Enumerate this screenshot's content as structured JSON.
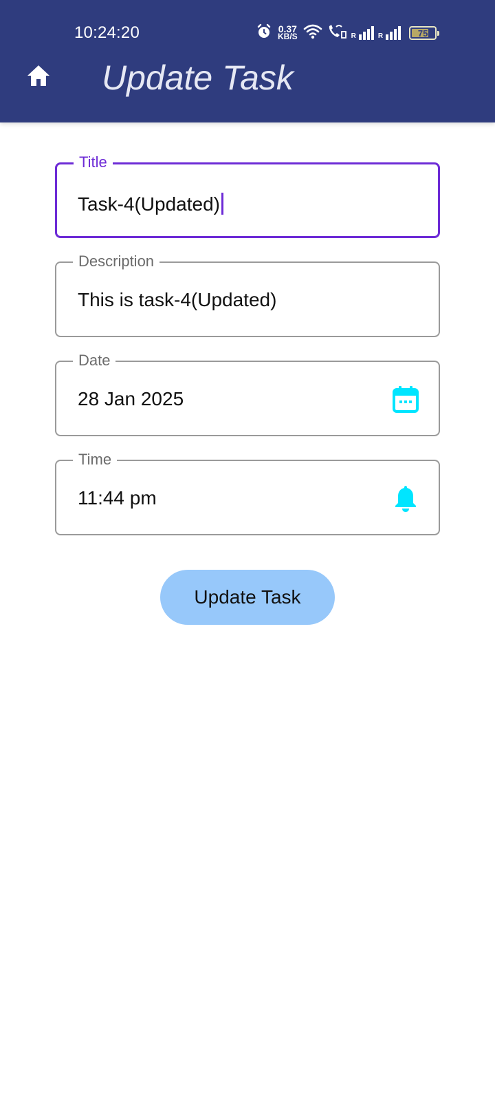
{
  "status_bar": {
    "time": "10:24:20",
    "net_speed_value": "0.37",
    "net_speed_unit": "KB/S",
    "sim1_label": "R",
    "sim2_label": "R",
    "battery_level": "75",
    "battery_fraction": 0.75,
    "icons": [
      "alarm-icon",
      "wifi-icon",
      "wifi-calling-icon",
      "signal-icon",
      "signal-icon",
      "battery-icon"
    ]
  },
  "app_bar": {
    "title": "Update Task",
    "nav_icon": "home-icon",
    "background_color": "#2f3c7e"
  },
  "form": {
    "title": {
      "label": "Title",
      "value": "Task-4(Updated)"
    },
    "description": {
      "label": "Description",
      "value": "This is task-4(Updated)"
    },
    "date": {
      "label": "Date",
      "value": "28 Jan 2025",
      "icon": "calendar-icon"
    },
    "time": {
      "label": "Time",
      "value": "11:44 pm",
      "icon": "bell-icon"
    }
  },
  "update_button": {
    "label": "Update Task",
    "color": "#97c8fa"
  },
  "colors": {
    "focus": "#6d2bd6",
    "icon_accent": "#00e5ff"
  }
}
